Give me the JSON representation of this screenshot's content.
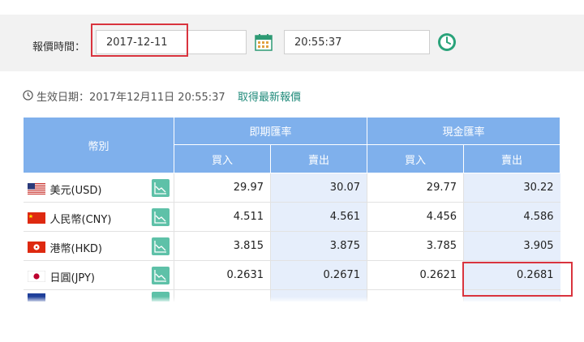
{
  "query": {
    "label": "報價時間：",
    "date_value": "2017-12-11",
    "time_value": "20:55:37"
  },
  "effective": {
    "text": "生效日期：2017年12月11日 20:55:37",
    "latest_link": "取得最新報價"
  },
  "table": {
    "col_currency": "幣別",
    "group_spot": "即期匯率",
    "group_cash": "現金匯率",
    "buy": "買入",
    "sell": "賣出",
    "rows": [
      {
        "name": "美元(USD)",
        "flag": "us-flag-icon",
        "spot_buy": "29.97",
        "spot_sell": "30.07",
        "cash_buy": "29.77",
        "cash_sell": "30.22"
      },
      {
        "name": "人民幣(CNY)",
        "flag": "cn-flag-icon",
        "spot_buy": "4.511",
        "spot_sell": "4.561",
        "cash_buy": "4.456",
        "cash_sell": "4.586"
      },
      {
        "name": "港幣(HKD)",
        "flag": "hk-flag-icon",
        "spot_buy": "3.815",
        "spot_sell": "3.875",
        "cash_buy": "3.785",
        "cash_sell": "3.905"
      },
      {
        "name": "日圓(JPY)",
        "flag": "jp-flag-icon",
        "spot_buy": "0.2631",
        "spot_sell": "0.2671",
        "cash_buy": "0.2621",
        "cash_sell": "0.2681"
      }
    ]
  },
  "colors": {
    "header_bg": "#7fb0ec",
    "alt_cell_bg": "#e6eefb",
    "highlight": "#d9343e",
    "accent": "#1f8a7a"
  }
}
